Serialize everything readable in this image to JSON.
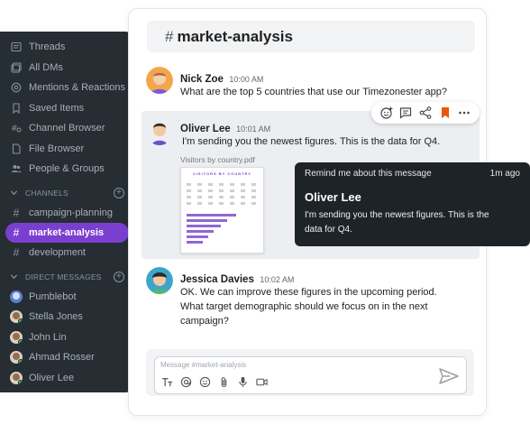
{
  "sidebar": {
    "nav": [
      {
        "label": "Threads",
        "icon": "threads-icon"
      },
      {
        "label": "All DMs",
        "icon": "dms-icon"
      },
      {
        "label": "Mentions & Reactions",
        "icon": "mention-icon"
      },
      {
        "label": "Saved Items",
        "icon": "bookmark-icon"
      },
      {
        "label": "Channel Browser",
        "icon": "channel-browser-icon"
      },
      {
        "label": "File Browser",
        "icon": "file-icon"
      },
      {
        "label": "People & Groups",
        "icon": "people-icon"
      }
    ],
    "channels_header": "CHANNELS",
    "channels": [
      {
        "label": "campaign-planning",
        "active": false
      },
      {
        "label": "market-analysis",
        "active": true
      },
      {
        "label": "development",
        "active": false
      }
    ],
    "dm_header": "DIRECT MESSAGES",
    "dms": [
      {
        "label": "Pumblebot"
      },
      {
        "label": "Stella Jones"
      },
      {
        "label": "John Lin"
      },
      {
        "label": "Ahmad Rosser"
      },
      {
        "label": "Oliver Lee"
      }
    ]
  },
  "channel": {
    "hash": "#",
    "name": "market-analysis"
  },
  "messages": [
    {
      "author": "Nick Zoe",
      "time": "10:00 AM",
      "body": "What are the top 5 countries that use our Timezonester app?"
    },
    {
      "author": "Oliver Lee",
      "time": "10:01 AM",
      "body": "I'm sending you the newest figures. This is the data for Q4.",
      "attachment_label": "Visitors by country.pdf",
      "attachment_heading": "VISITORS BY COUNTRY"
    },
    {
      "author": "Jessica Davies",
      "time": "10:02 AM",
      "body_lines": [
        "OK. We can improve these figures in the upcoming period.",
        "What target demographic should we focus on in the next",
        "campaign?"
      ]
    }
  ],
  "reminder": {
    "title": "Remind me about this message",
    "ago": "1m ago",
    "author": "Oliver Lee",
    "body_lines": [
      "I'm sending you the newest figures. This is the",
      "data for Q4."
    ]
  },
  "composer": {
    "placeholder": "Message #market-analysis"
  },
  "colors": {
    "sidebar_bg": "#262d33",
    "active_channel": "#7b3fd0",
    "bookmark": "#e8590c",
    "tooltip_bg": "#1e2328"
  }
}
